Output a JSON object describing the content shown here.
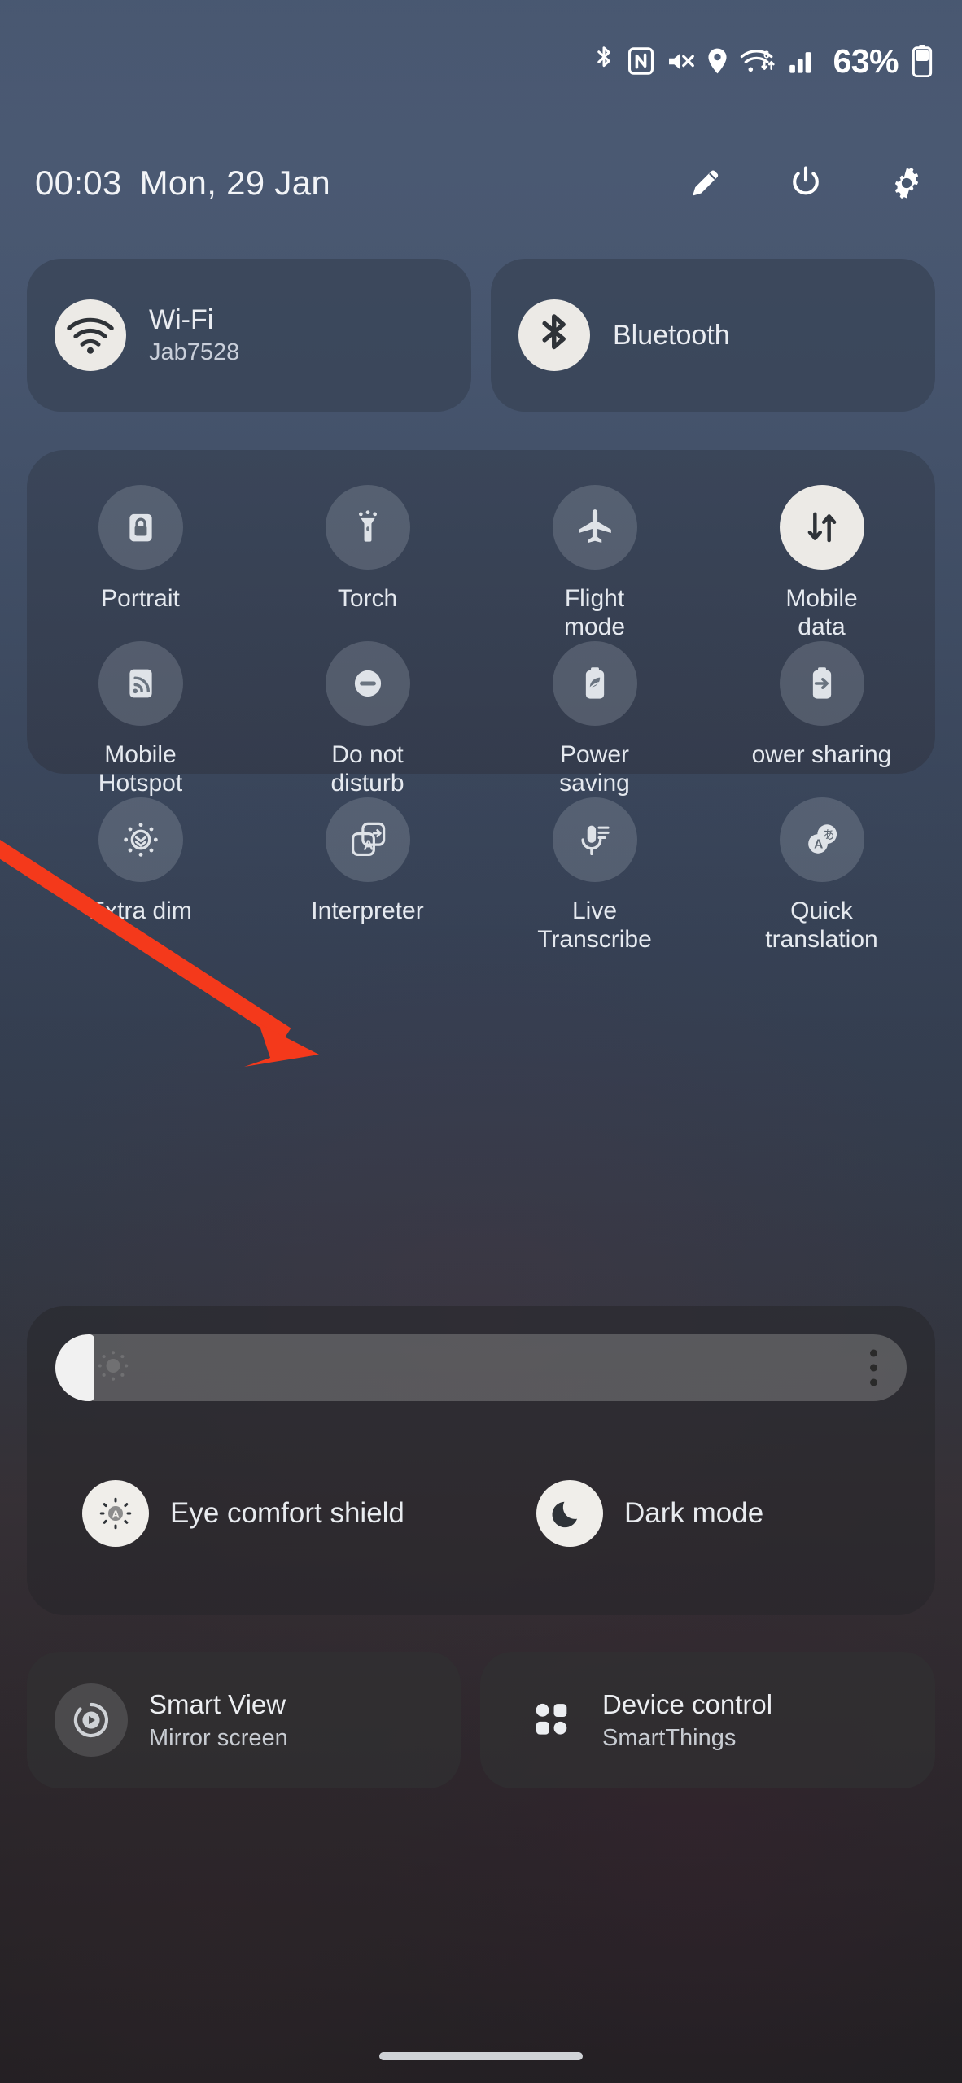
{
  "status_bar": {
    "icons": [
      "bluetooth-icon",
      "nfc-icon",
      "mute-icon",
      "location-icon",
      "wifi-icon",
      "signal-icon"
    ],
    "wifi_generation": "6",
    "battery_percent": "63%"
  },
  "header": {
    "time": "00:03",
    "date": "Mon, 29 Jan",
    "actions": [
      {
        "name": "edit-icon",
        "label": "Edit"
      },
      {
        "name": "power-icon",
        "label": "Power"
      },
      {
        "name": "settings-icon",
        "label": "Settings"
      }
    ]
  },
  "connectivity": {
    "tiles": [
      {
        "title": "Wi-Fi",
        "subtitle": "Jab7528",
        "icon": "wifi-icon",
        "active": true
      },
      {
        "title": "Bluetooth",
        "subtitle": "",
        "icon": "bluetooth-icon",
        "active": true
      }
    ]
  },
  "quick_toggles": [
    {
      "label": "Portrait",
      "icon": "rotation-lock-icon",
      "active": false
    },
    {
      "label": "Torch",
      "icon": "flashlight-icon",
      "active": false
    },
    {
      "label": "Flight\nmode",
      "icon": "airplane-icon",
      "active": false
    },
    {
      "label": "Mobile\ndata",
      "icon": "mobile-data-icon",
      "active": true
    },
    {
      "label": "Mobile\nHotspot",
      "icon": "hotspot-icon",
      "active": false
    },
    {
      "label": "Do not\ndisturb",
      "icon": "do-not-disturb-icon",
      "active": false
    },
    {
      "label": "Power\nsaving",
      "icon": "power-saving-icon",
      "active": false
    },
    {
      "label": "ower sharing",
      "icon": "power-sharing-icon",
      "active": false
    },
    {
      "label": "Extra dim",
      "icon": "extra-dim-icon",
      "active": false
    },
    {
      "label": "Interpreter",
      "icon": "interpreter-icon",
      "active": false
    },
    {
      "label": "Live\nTranscribe",
      "icon": "live-transcribe-icon",
      "active": false
    },
    {
      "label": "Quick\ntranslation",
      "icon": "quick-translation-icon",
      "active": false
    }
  ],
  "brightness": {
    "icon": "brightness-icon",
    "menu_icon": "more-options-icon",
    "level_percent": 4
  },
  "display_modes": [
    {
      "label": "Eye comfort shield",
      "icon": "eye-comfort-icon",
      "active": true
    },
    {
      "label": "Dark mode",
      "icon": "moon-icon",
      "active": true
    }
  ],
  "shortcuts": [
    {
      "title": "Smart View",
      "subtitle": "Mirror screen",
      "icon": "smart-view-icon"
    },
    {
      "title": "Device control",
      "subtitle": "SmartThings",
      "icon": "grid-dots-icon"
    }
  ],
  "navigation": {
    "gesture_bar": "home-gesture-bar"
  },
  "annotation": {
    "arrow_color": "#f4391b",
    "points_at": "Interpreter"
  }
}
